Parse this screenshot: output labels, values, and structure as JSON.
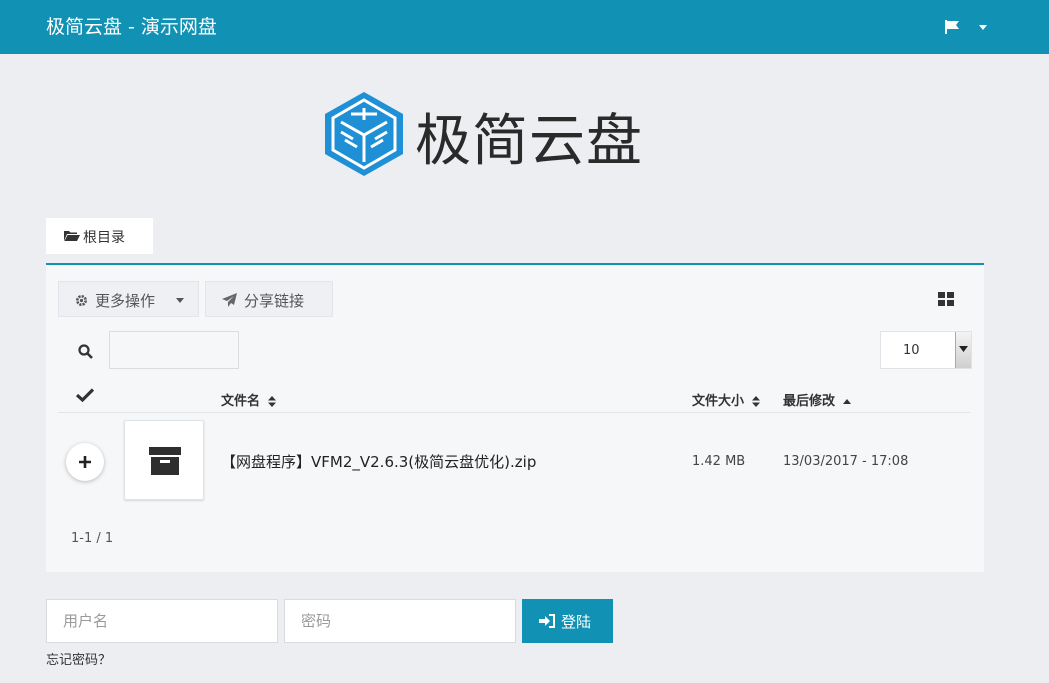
{
  "header": {
    "title": "极简云盘 - 演示网盘",
    "language_icon": "flag-icon"
  },
  "logo": {
    "text": "极简云盘",
    "icon": "cube-logo-icon"
  },
  "breadcrumb": {
    "root_label": "根目录"
  },
  "toolbar": {
    "more_label": "更多操作",
    "share_label": "分享链接"
  },
  "search": {
    "value": "",
    "placeholder": ""
  },
  "per_page": {
    "selected": "10"
  },
  "table": {
    "columns": {
      "name": "文件名",
      "size": "文件大小",
      "modified": "最后修改"
    },
    "rows": [
      {
        "name": "【网盘程序】VFM2_V2.6.3(极简云盘优化).zip",
        "size": "1.42 MB",
        "modified": "13/03/2017 - 17:08"
      }
    ]
  },
  "pagination": {
    "text": "1-1 / 1"
  },
  "login": {
    "username_placeholder": "用户名",
    "password_placeholder": "密码",
    "submit_label": "登陆",
    "forgot_label": "忘记密码？"
  },
  "colors": {
    "accent": "#1192b4",
    "background": "#eceef1",
    "panel": "#f5f7f9"
  }
}
